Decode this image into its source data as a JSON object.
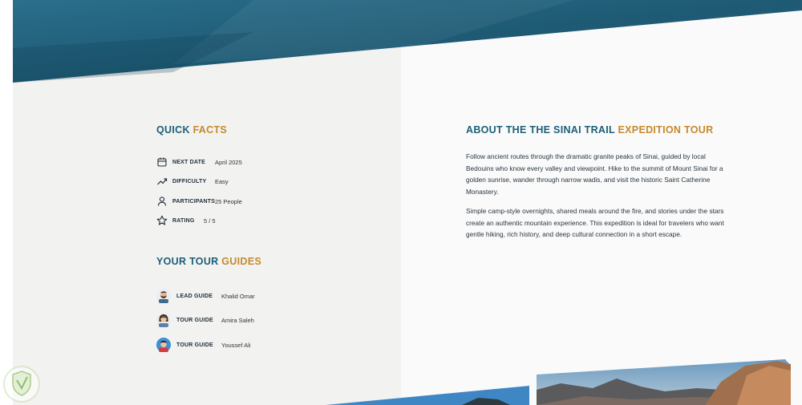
{
  "quick_facts": {
    "title_part1": "QUICK",
    "title_part2": "FACTS",
    "items": [
      {
        "icon": "calendar-icon",
        "label": "NEXT DATE",
        "value": "April 2025"
      },
      {
        "icon": "trend-up-icon",
        "label": "DIFFICULTY",
        "value": "Easy"
      },
      {
        "icon": "user-icon",
        "label": "PARTICIPANTS",
        "value": "25 People"
      },
      {
        "icon": "star-icon",
        "label": "RATING",
        "value": "5 / 5"
      }
    ]
  },
  "tour_guides": {
    "title_part1": "YOUR TOUR",
    "title_part2": "GUIDES",
    "items": [
      {
        "avatar": "bearded-man-avatar",
        "label": "LEAD GUIDE",
        "name": "Khalid Omar"
      },
      {
        "avatar": "woman-avatar",
        "label": "TOUR GUIDE",
        "name": "Amira Saleh"
      },
      {
        "avatar": "man-avatar",
        "label": "TOUR GUIDE",
        "name": "Youssef Ali"
      }
    ]
  },
  "about": {
    "title_part1": "ABOUT THE THE SINAI TRAIL",
    "title_part2": "EXPEDITION TOUR",
    "paragraph1": "Follow ancient routes through the dramatic granite peaks of Sinai, guided by local Bedouins who know every valley and viewpoint. Hike to the summit of Mount Sinai for a golden sunrise, wander through narrow wadis, and visit the historic Saint Catherine Monastery.",
    "paragraph2": "Simple camp-style overnights, shared meals around the fire, and stories under the stars create an authentic mountain experience. This expedition is ideal for travelers who want gentle hiking, rich history, and deep cultural connection in a short escape."
  },
  "colors": {
    "accent_blue": "#1b5f78",
    "accent_gold": "#c68a2c",
    "hero_teal": "#1e5a74"
  }
}
